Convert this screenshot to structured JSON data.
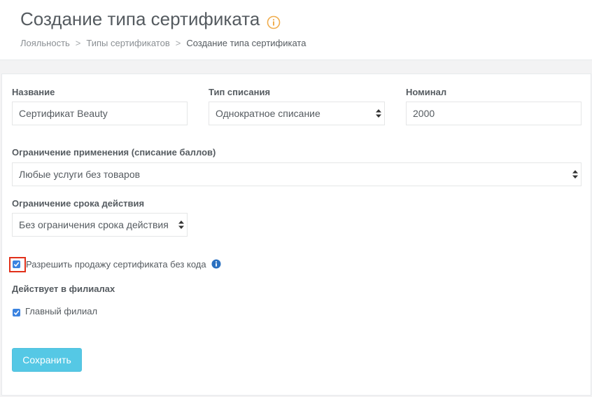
{
  "header": {
    "title": "Создание типа сертификата",
    "breadcrumb": [
      "Лояльность",
      "Типы сертификатов",
      "Создание типа сертификата"
    ],
    "separator": ">"
  },
  "form": {
    "name": {
      "label": "Название",
      "value": "Сертификат Beauty"
    },
    "writeoff_type": {
      "label": "Тип списания",
      "value": "Однократное списание"
    },
    "nominal": {
      "label": "Номинал",
      "value": "2000"
    },
    "usage_restriction": {
      "label": "Ограничение применения (списание баллов)",
      "value": "Любые услуги без товаров"
    },
    "validity_restriction": {
      "label": "Ограничение срока действия",
      "value": "Без ограничения срока действия"
    },
    "allow_sale_without_code": {
      "label": "Разрешить продажу сертификата без кода",
      "checked": true
    },
    "branches": {
      "label": "Действует в филиалах",
      "items": [
        {
          "label": "Главный филиал",
          "checked": true
        }
      ]
    },
    "save_label": "Сохранить"
  },
  "colors": {
    "accent_orange": "#f0ad4e",
    "checkbox_blue": "#3b83e0",
    "highlight_red": "#e1301a",
    "button_cyan": "#55c8e5"
  }
}
